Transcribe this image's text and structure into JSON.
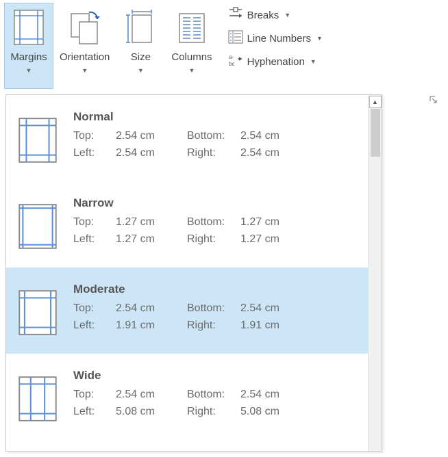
{
  "ribbon": {
    "margins": "Margins",
    "orientation": "Orientation",
    "size": "Size",
    "columns": "Columns",
    "breaks": "Breaks",
    "lineNumbers": "Line Numbers",
    "hyphenation": "Hyphenation"
  },
  "presets": [
    {
      "name": "Normal",
      "top": "2.54 cm",
      "bottom": "2.54 cm",
      "left": "2.54 cm",
      "right": "2.54 cm",
      "highlight": false
    },
    {
      "name": "Narrow",
      "top": "1.27 cm",
      "bottom": "1.27 cm",
      "left": "1.27 cm",
      "right": "1.27 cm",
      "highlight": false
    },
    {
      "name": "Moderate",
      "top": "2.54 cm",
      "bottom": "2.54 cm",
      "left": "1.91 cm",
      "right": "1.91 cm",
      "highlight": true
    },
    {
      "name": "Wide",
      "top": "2.54 cm",
      "bottom": "2.54 cm",
      "left": "5.08 cm",
      "right": "5.08 cm",
      "highlight": false
    }
  ],
  "labels": {
    "top": "Top:",
    "bottom": "Bottom:",
    "left": "Left:",
    "right": "Right:"
  }
}
